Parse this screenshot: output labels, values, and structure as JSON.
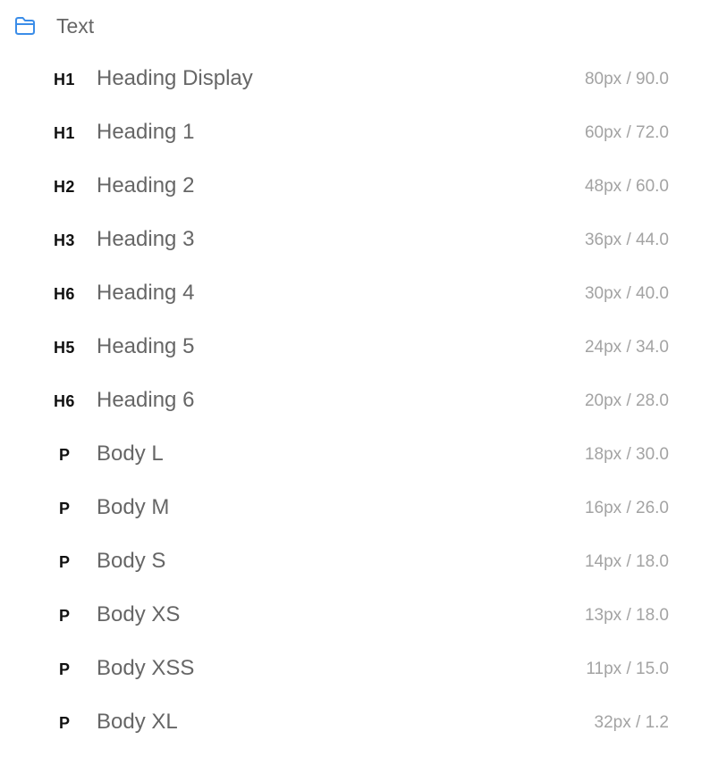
{
  "folder": {
    "icon": "folder-icon",
    "title": "Text",
    "accent_color": "#3b8de8"
  },
  "styles": [
    {
      "tag": "H1",
      "name": "Heading Display",
      "spec": "80px / 90.0"
    },
    {
      "tag": "H1",
      "name": "Heading 1",
      "spec": "60px / 72.0"
    },
    {
      "tag": "H2",
      "name": "Heading 2",
      "spec": "48px / 60.0"
    },
    {
      "tag": "H3",
      "name": "Heading 3",
      "spec": "36px / 44.0"
    },
    {
      "tag": "H6",
      "name": "Heading 4",
      "spec": "30px / 40.0"
    },
    {
      "tag": "H5",
      "name": "Heading 5",
      "spec": "24px / 34.0"
    },
    {
      "tag": "H6",
      "name": "Heading 6",
      "spec": "20px / 28.0"
    },
    {
      "tag": "P",
      "name": "Body L",
      "spec": "18px / 30.0"
    },
    {
      "tag": "P",
      "name": "Body M",
      "spec": "16px / 26.0"
    },
    {
      "tag": "P",
      "name": "Body S",
      "spec": "14px / 18.0"
    },
    {
      "tag": "P",
      "name": "Body XS",
      "spec": "13px / 18.0"
    },
    {
      "tag": "P",
      "name": "Body XSS",
      "spec": "11px / 15.0"
    },
    {
      "tag": "P",
      "name": "Body XL",
      "spec": "32px / 1.2"
    }
  ]
}
